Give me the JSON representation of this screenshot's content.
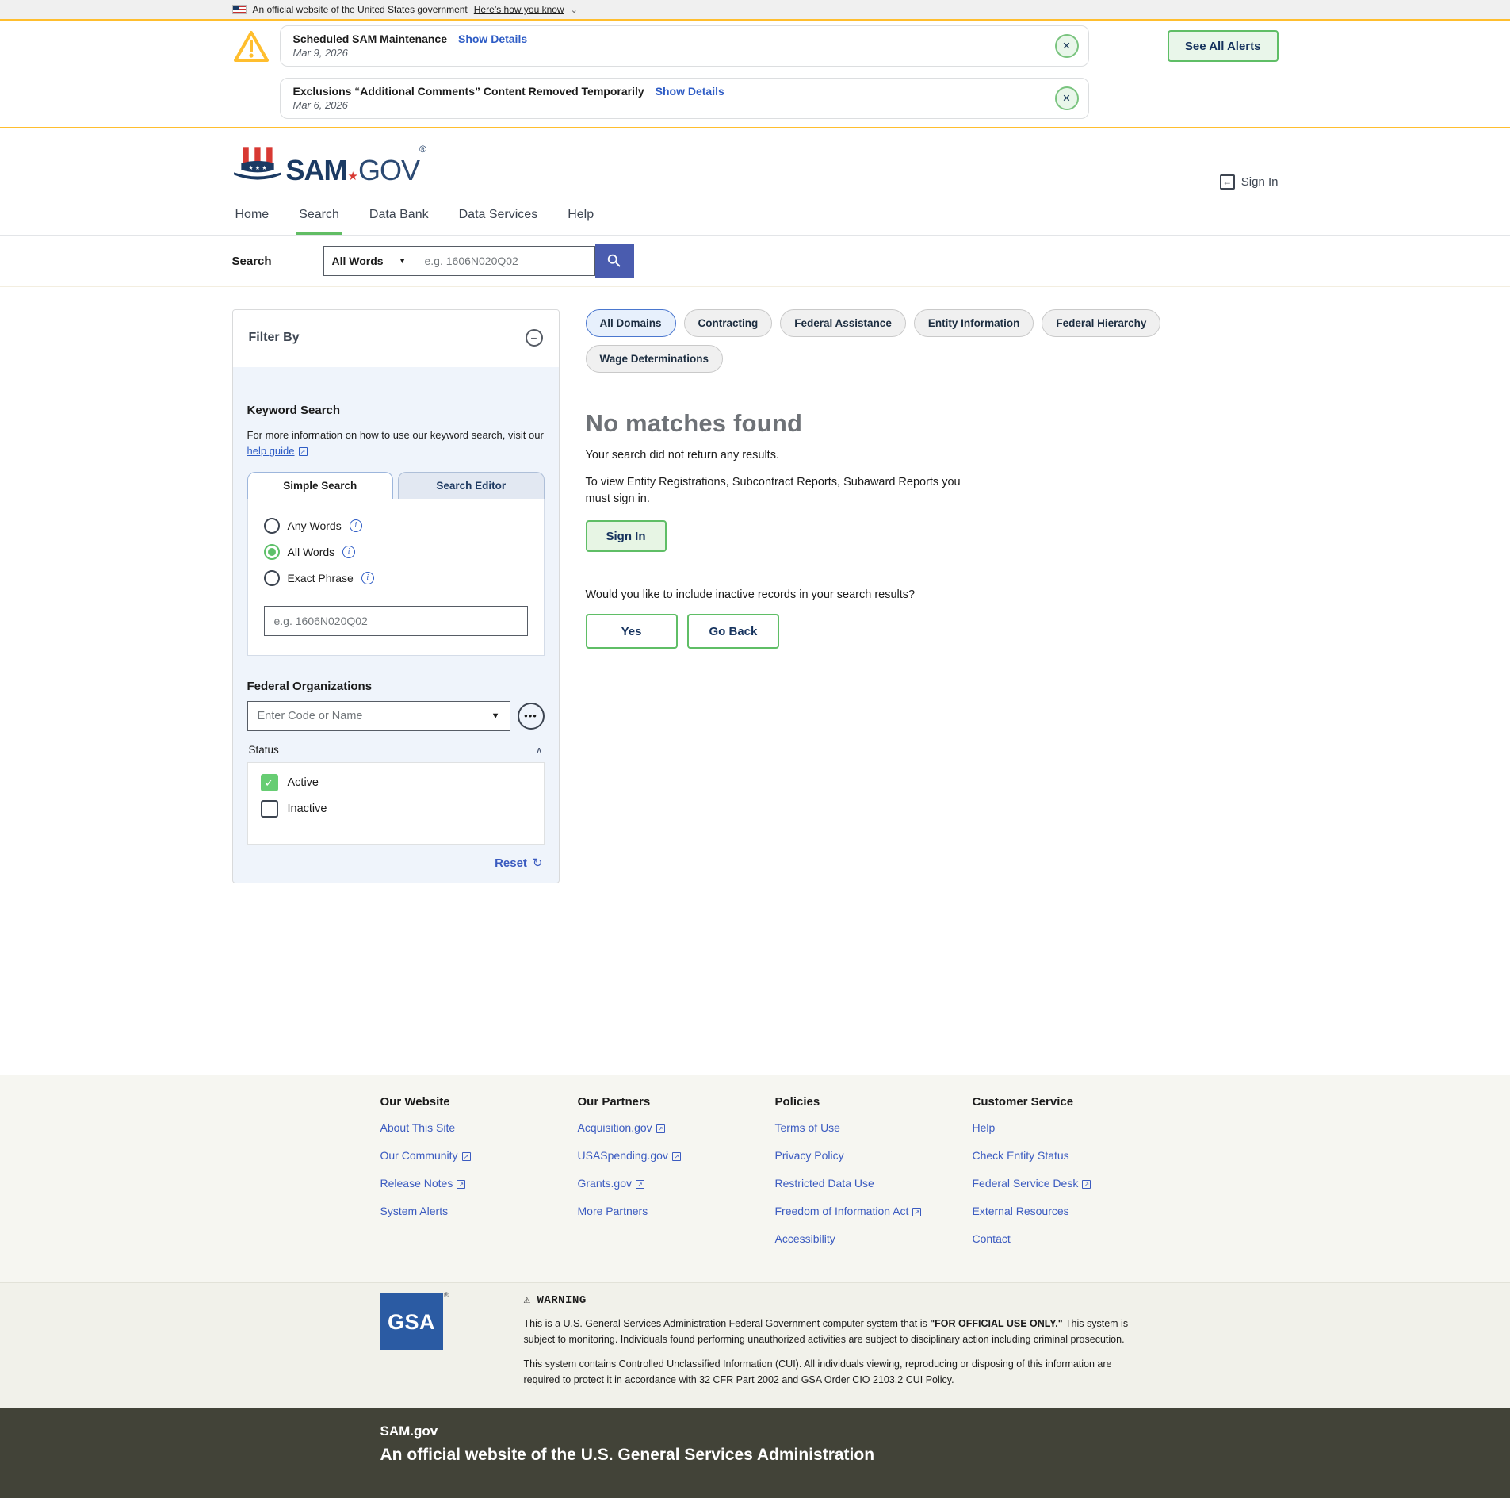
{
  "gov": {
    "text": "An official website of the United States government",
    "link": "Here’s how you know"
  },
  "alerts": {
    "see_all": "See All Alerts",
    "items": [
      {
        "title": "Scheduled SAM Maintenance",
        "details": "Show Details",
        "date": "Mar 9, 2026"
      },
      {
        "title": "Exclusions “Additional Comments” Content Removed Temporarily",
        "details": "Show Details",
        "date": "Mar 6, 2026"
      }
    ]
  },
  "header": {
    "sam": "SAM",
    "star": "★",
    "gov": "GOV",
    "reg": "®",
    "sign_in": "Sign In"
  },
  "nav": {
    "items": [
      {
        "label": "Home",
        "active": false
      },
      {
        "label": "Search",
        "active": true
      },
      {
        "label": "Data Bank",
        "active": false
      },
      {
        "label": "Data Services",
        "active": false
      },
      {
        "label": "Help",
        "active": false
      }
    ]
  },
  "search_bar": {
    "label": "Search",
    "mode": "All Words",
    "placeholder": "e.g. 1606N020Q02"
  },
  "filter": {
    "title": "Filter By",
    "keyword": {
      "heading": "Keyword Search",
      "info": "For more information on how to use our keyword search, visit our",
      "help_link": "help guide",
      "tabs": [
        "Simple Search",
        "Search Editor"
      ],
      "radios": [
        {
          "label": "Any Words",
          "selected": false
        },
        {
          "label": "All Words",
          "selected": true
        },
        {
          "label": "Exact Phrase",
          "selected": false
        }
      ],
      "placeholder": "e.g. 1606N020Q02"
    },
    "orgs": {
      "heading": "Federal Organizations",
      "placeholder": "Enter Code or Name"
    },
    "status": {
      "label": "Status",
      "options": [
        {
          "label": "Active",
          "checked": true
        },
        {
          "label": "Inactive",
          "checked": false
        }
      ]
    },
    "reset": "Reset"
  },
  "results": {
    "tabs": [
      {
        "label": "All Domains",
        "active": true
      },
      {
        "label": "Contracting",
        "active": false
      },
      {
        "label": "Federal Assistance",
        "active": false
      },
      {
        "label": "Entity Information",
        "active": false
      },
      {
        "label": "Federal Hierarchy",
        "active": false
      },
      {
        "label": "Wage Determinations",
        "active": false
      }
    ],
    "heading": "No matches found",
    "line1": "Your search did not return any results.",
    "line2": "To view Entity Registrations, Subcontract Reports, Subaward Reports you must sign in.",
    "sign_in": "Sign In",
    "question": "Would you like to include inactive records in your search results?",
    "yes": "Yes",
    "go_back": "Go Back"
  },
  "footer": {
    "columns": [
      {
        "heading": "Our Website",
        "links": [
          {
            "label": "About This Site",
            "external": false
          },
          {
            "label": "Our Community",
            "external": true
          },
          {
            "label": "Release Notes",
            "external": true
          },
          {
            "label": "System Alerts",
            "external": false
          }
        ]
      },
      {
        "heading": "Our Partners",
        "links": [
          {
            "label": "Acquisition.gov",
            "external": true
          },
          {
            "label": "USASpending.gov",
            "external": true
          },
          {
            "label": "Grants.gov",
            "external": true
          },
          {
            "label": "More Partners",
            "external": false
          }
        ]
      },
      {
        "heading": "Policies",
        "links": [
          {
            "label": "Terms of Use",
            "external": false
          },
          {
            "label": "Privacy Policy",
            "external": false
          },
          {
            "label": "Restricted Data Use",
            "external": false
          },
          {
            "label": "Freedom of Information Act",
            "external": true
          },
          {
            "label": "Accessibility",
            "external": false
          }
        ]
      },
      {
        "heading": "Customer Service",
        "links": [
          {
            "label": "Help",
            "external": false
          },
          {
            "label": "Check Entity Status",
            "external": false
          },
          {
            "label": "Federal Service Desk",
            "external": true
          },
          {
            "label": "External Resources",
            "external": false
          },
          {
            "label": "Contact",
            "external": false
          }
        ]
      }
    ],
    "gsa": {
      "text": "GSA",
      "reg": "®"
    },
    "warning": {
      "heading": "WARNING",
      "p1_pre": "This is a U.S. General Services Administration Federal Government computer system that is ",
      "p1_bold": "\"FOR OFFICIAL USE ONLY.\"",
      "p1_post": " This system is subject to monitoring. Individuals found performing unauthorized activities are subject to disciplinary action including criminal prosecution.",
      "p2": "This system contains Controlled Unclassified Information (CUI). All individuals viewing, reproducing or disposing of this information are required to protect it in accordance with 32 CFR Part 2002 and GSA Order CIO 2103.2 CUI Policy."
    },
    "identifier": {
      "title": "SAM.gov",
      "subtitle": "An official website of the U.S. General Services Administration"
    }
  },
  "icons": {
    "close": "×",
    "dropdown": "▼",
    "chevron_down": "⌄",
    "chevron_up": "∧",
    "ellipsis": "•••",
    "reset": "↻",
    "external": "↗",
    "warning": "⚠",
    "minus": "−",
    "info": "i",
    "arrow_left": "←",
    "check": "✓"
  },
  "colors": {
    "accent_green": "#5fbe66",
    "checkbox_green": "#67cd73",
    "link_blue": "#2e5cc5",
    "alert_gold": "#ffbe2e",
    "search_button_blue": "#4a5caf",
    "button_text_navy": "#16335e",
    "gsa_blue": "#2b5ba3",
    "identifier_bar": "#424338",
    "heading_gray": "#6e7277"
  }
}
